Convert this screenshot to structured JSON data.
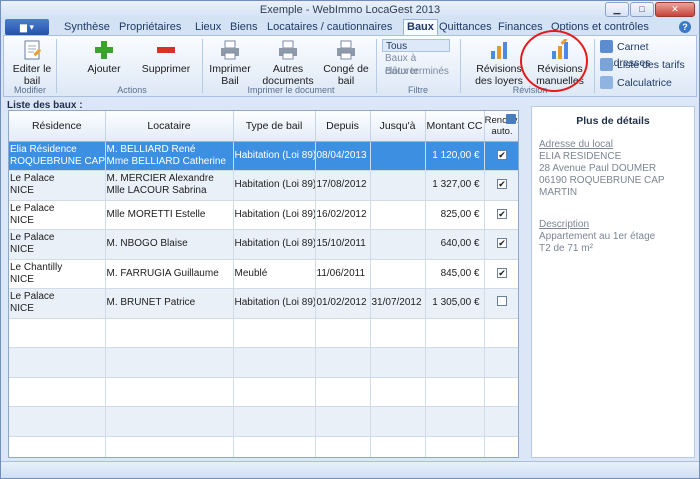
{
  "window": {
    "title": "Exemple - WebImmo LocaGest 2013",
    "minimize": "▁",
    "maximize": "□",
    "close": "✕"
  },
  "menu_tabs": [
    "Synthèse",
    "Propriétaires",
    "Lieux",
    "Biens",
    "Locataires / cautionnaires",
    "Baux",
    "Quittances",
    "Finances",
    "Options et contrôles"
  ],
  "active_tab": "Baux",
  "ribbon": {
    "edit_bail": "Editer le bail",
    "group_modifier": "Modifier",
    "ajouter": "Ajouter",
    "supprimer": "Supprimer",
    "group_actions": "Actions",
    "imprimer_bail": "Imprimer Bail",
    "autres_documents": "Autres documents",
    "conge_bail": "Congé de bail",
    "group_imprimer": "Imprimer le document",
    "filter_items": [
      "Tous",
      "Baux à clôturer",
      "Baux terminés"
    ],
    "group_filtre": "Filtre",
    "revisions_loyers": "Révisions des loyers",
    "revisions_manuelles": "Révisions manuelles",
    "group_revision": "Révision",
    "carnet_adresses": "Carnet d'adresses",
    "liste_tarifs": "Liste des tarifs",
    "calculatrice": "Calculatrice"
  },
  "list_title": "Liste des baux :",
  "table": {
    "headers": [
      "Résidence",
      "Locataire",
      "Type de bail",
      "Depuis",
      "Jusqu'à",
      "Montant CC",
      "Renouv. auto."
    ],
    "rows": [
      {
        "residence": [
          "Elia Résidence",
          "ROQUEBRUNE CAP MA"
        ],
        "locataire": [
          "M. BELLIARD René",
          "Mme BELLIARD Catherine"
        ],
        "type": "Habitation (Loi 89)",
        "depuis": "08/04/2013",
        "jusqua": "",
        "montant": "1 120,00 €",
        "renouv": true
      },
      {
        "residence": [
          "Le Palace",
          "NICE"
        ],
        "locataire": [
          "M. MERCIER Alexandre",
          "Mlle LACOUR Sabrina"
        ],
        "type": "Habitation (Loi 89)",
        "depuis": "17/08/2012",
        "jusqua": "",
        "montant": "1 327,00 €",
        "renouv": true
      },
      {
        "residence": [
          "Le Palace",
          "NICE"
        ],
        "locataire": [
          "Mlle MORETTI Estelle"
        ],
        "type": "Habitation (Loi 89)",
        "depuis": "16/02/2012",
        "jusqua": "",
        "montant": "825,00 €",
        "renouv": true
      },
      {
        "residence": [
          "Le Palace",
          "NICE"
        ],
        "locataire": [
          "M. NBOGO Blaise"
        ],
        "type": "Habitation (Loi 89)",
        "depuis": "15/10/2011",
        "jusqua": "",
        "montant": "640,00 €",
        "renouv": true
      },
      {
        "residence": [
          "Le Chantilly",
          "NICE"
        ],
        "locataire": [
          "M. FARRUGIA Guillaume"
        ],
        "type": "Meublé",
        "depuis": "11/06/2011",
        "jusqua": "",
        "montant": "845,00 €",
        "renouv": true
      },
      {
        "residence": [
          "Le Palace",
          "NICE"
        ],
        "locataire": [
          "M. BRUNET Patrice"
        ],
        "type": "Habitation (Loi 89)",
        "depuis": "01/02/2012",
        "jusqua": "31/07/2012",
        "montant": "1 305,00 €",
        "renouv": false
      }
    ]
  },
  "details": {
    "title": "Plus de détails",
    "address_label": "Adresse du local",
    "address_lines": [
      "ELIA RESIDENCE",
      "28 Avenue Paul DOUMER",
      "06190 ROQUEBRUNE CAP MARTIN"
    ],
    "description_label": "Description",
    "description_lines": [
      "Appartement au 1er étage",
      "T2 de 71 m²"
    ]
  },
  "colors": {
    "selection": "#3d8fe2",
    "highlight_circle": "#e31b1b",
    "accent": "#2452a8"
  }
}
